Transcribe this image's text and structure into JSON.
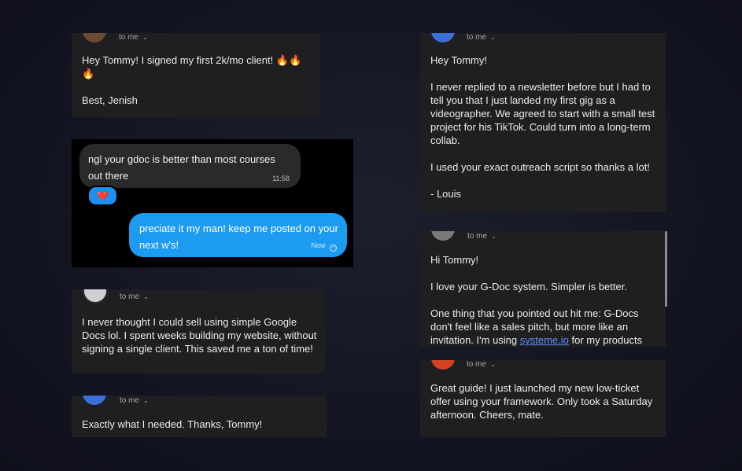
{
  "emails": [
    {
      "id": "jenish",
      "to_label": "to me",
      "avatar_color": "#6b4a34",
      "paragraphs": [
        "Hey Tommy! I signed my first 2k/mo client! 🔥🔥🔥",
        "Best, Jenish"
      ]
    },
    {
      "id": "louis",
      "to_label": "to me",
      "avatar_color": "#3b6fd8",
      "paragraphs": [
        "Hey Tommy!",
        "I never replied to a newsletter before but I had to tell you that I just landed my first gig as a videographer. We agreed to start with a small test project for his TikTok. Could turn into a long-term collab.",
        "I used your exact outreach script so thanks a lot!",
        "- Louis"
      ]
    },
    {
      "id": "gdocs",
      "to_label": "to me",
      "avatar_color": "#d0d0d0",
      "paragraphs": [
        "I never thought I could sell using simple Google Docs lol. I spent weeks building my website, without signing a single client. This saved me a ton of time!"
      ]
    },
    {
      "id": "gdoc-system",
      "to_label": "to me",
      "avatar_color": "#7a7a7a",
      "greeting": "Hi Tommy!",
      "line2": "I love your G-Doc system. Simpler is better.",
      "line3_before": "One thing that you pointed out hit me: G-Docs don't feel like a sales pitch, but more like an invitation. I'm using ",
      "line3_link": "systeme.io",
      "line3_after": " for my products"
    },
    {
      "id": "exactly",
      "to_label": "to me",
      "avatar_color": "#3b6fd8",
      "paragraphs": [
        "Exactly what I needed. Thanks, Tommy!"
      ]
    },
    {
      "id": "guide",
      "to_label": "to me",
      "avatar_color": "#d5421f",
      "paragraphs": [
        "Great guide! I just launched my new low-ticket offer using your framework. Only took a Saturday afternoon. Cheers, mate."
      ]
    }
  ],
  "chat": {
    "incoming": {
      "text": "ngl your gdoc is better than most courses out there",
      "time": "11:58"
    },
    "reaction": "❤️",
    "outgoing": {
      "text": "preciate it my man! keep me posted on your next w's!",
      "time": "Now"
    }
  }
}
